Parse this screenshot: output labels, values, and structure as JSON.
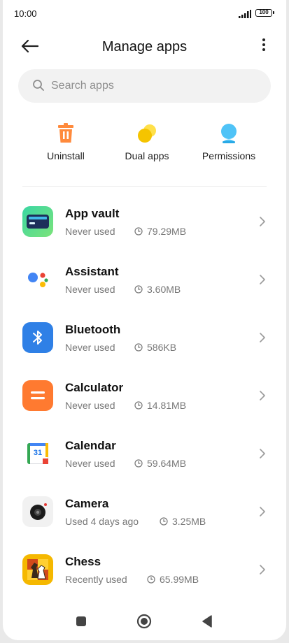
{
  "status_bar": {
    "time": "10:00",
    "battery": "100"
  },
  "header": {
    "title": "Manage apps"
  },
  "search": {
    "placeholder": "Search apps"
  },
  "actions": [
    {
      "label": "Uninstall",
      "icon": "trash-icon",
      "color": "#FF8A3C"
    },
    {
      "label": "Dual apps",
      "icon": "dual-circles-icon",
      "color": "#F5C400"
    },
    {
      "label": "Permissions",
      "icon": "permissions-icon",
      "color": "#4FC3F7"
    }
  ],
  "apps": [
    {
      "name": "App vault",
      "usage": "Never used",
      "size": "79.29MB",
      "icon": "app-vault-icon"
    },
    {
      "name": "Assistant",
      "usage": "Never used",
      "size": "3.60MB",
      "icon": "assistant-icon"
    },
    {
      "name": "Bluetooth",
      "usage": "Never used",
      "size": "586KB",
      "icon": "bluetooth-icon"
    },
    {
      "name": "Calculator",
      "usage": "Never used",
      "size": "14.81MB",
      "icon": "calculator-icon"
    },
    {
      "name": "Calendar",
      "usage": "Never used",
      "size": "59.64MB",
      "icon": "calendar-icon",
      "icon_text": "31"
    },
    {
      "name": "Camera",
      "usage": "Used 4 days ago",
      "size": "3.25MB",
      "icon": "camera-icon"
    },
    {
      "name": "Chess",
      "usage": "Recently used",
      "size": "65.99MB",
      "icon": "chess-icon"
    }
  ],
  "nav_bar": {
    "items": [
      "square-icon",
      "circle-icon",
      "back-triangle-icon"
    ]
  }
}
